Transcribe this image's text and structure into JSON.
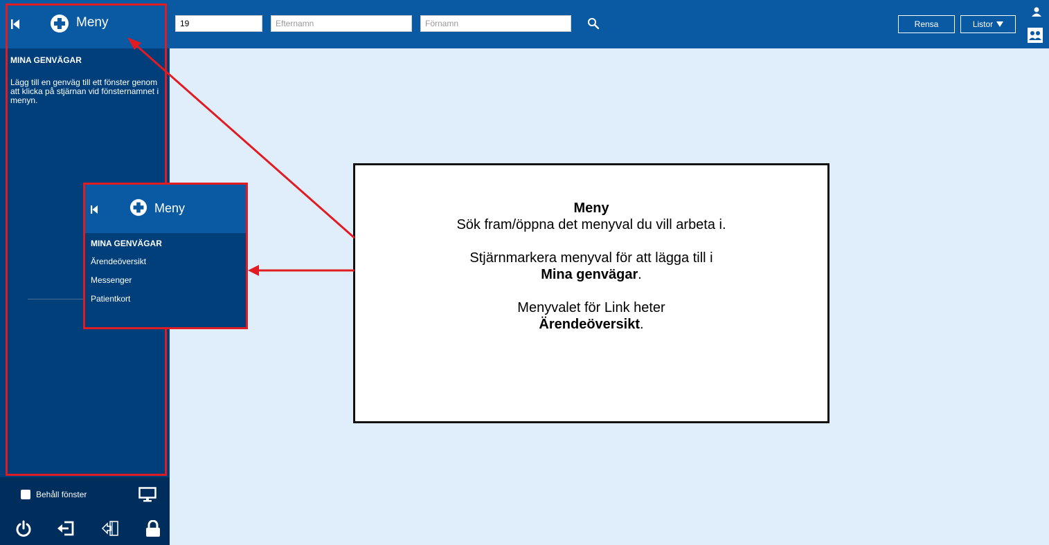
{
  "sidebar": {
    "menu_title": "Meny",
    "shortcuts_heading": "MINA GENVÄGAR",
    "shortcuts_hint": "Lägg till en genväg till ett fönster genom att klicka på stjärnan vid fönsternamnet i menyn.",
    "keep_window_label": "Behåll fönster"
  },
  "topbar": {
    "field1_value": "19",
    "field2_placeholder": "Efternamn",
    "field3_placeholder": "Förnamn",
    "clear_button": "Rensa",
    "lists_button": "Listor"
  },
  "inset": {
    "menu_title": "Meny",
    "heading": "MINA GENVÄGAR",
    "items": [
      "Ärendeöversikt",
      "Messenger",
      "Patientkort"
    ]
  },
  "callout": {
    "title": "Meny",
    "line1": "Sök fram/öppna det menyval du vill arbeta i.",
    "line2": "Stjärnmarkera menyval för att lägga till i",
    "line2_bold": "Mina genvägar",
    "line2_end": ".",
    "line3": "Menyvalet för Link heter",
    "line3_bold": "Ärendeöversikt",
    "line3_end": "."
  },
  "colors": {
    "header_blue": "#0a5aa3",
    "sidebar_blue": "#003f7a",
    "content_bg": "#e0edfb",
    "annotation_red": "#e11b22"
  },
  "icons": [
    "collapse-icon",
    "plus-circle-icon",
    "search-icon",
    "caret-down-icon",
    "user-icon",
    "group-icon",
    "monitor-icon",
    "power-icon",
    "logout-icon",
    "switch-user-icon",
    "lock-icon"
  ]
}
